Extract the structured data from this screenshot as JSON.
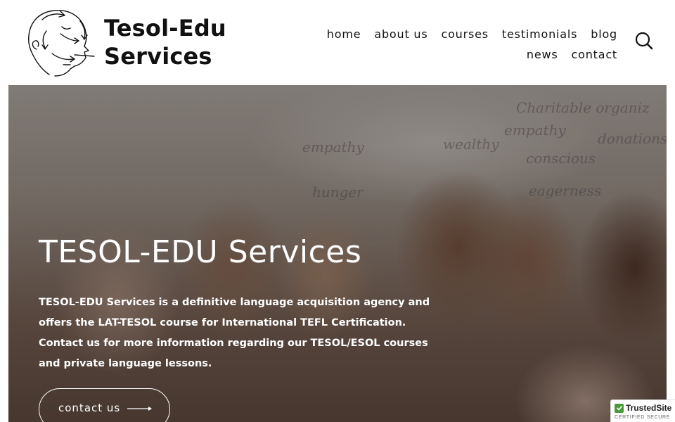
{
  "site": {
    "title_line1": "Tesol-Edu",
    "title_line2": "Services"
  },
  "nav": {
    "row1": [
      "home",
      "about us",
      "courses",
      "testimonials",
      "blog"
    ],
    "row2": [
      "news",
      "contact"
    ]
  },
  "search": {
    "icon": "search-icon"
  },
  "hero": {
    "title": "TESOL-EDU Services",
    "description": "TESOL-EDU Services is a definitive language acquisition agency and offers the LAT-TESOL course for International TEFL Certification. Contact us for more information regarding our TESOL/ESOL courses and private language lessons.",
    "button_label": "contact us",
    "board_words": [
      "Charitable organiz",
      "empathy",
      "donations",
      "wealthy",
      "conscious",
      "hunger",
      "empathy",
      "eagerness"
    ]
  },
  "trust_badge": {
    "name": "TrustedSite",
    "sub": "CERTIFIED SECURE",
    "color": "#4a9a3a"
  }
}
